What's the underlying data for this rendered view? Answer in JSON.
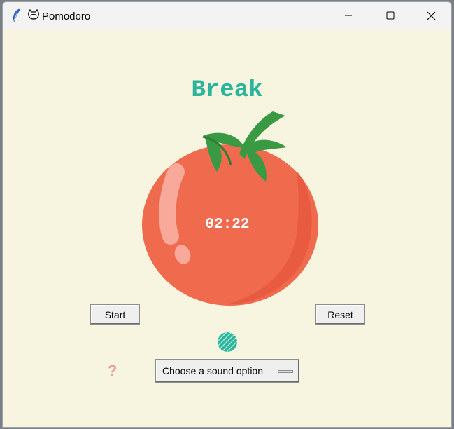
{
  "window": {
    "title": "Pomodoro"
  },
  "main": {
    "heading": "Break",
    "timer": "02:22",
    "heading_color": "#2bb59a",
    "tomato_color": "#f06a4e"
  },
  "buttons": {
    "start": "Start",
    "reset": "Reset"
  },
  "help": {
    "label": "?"
  },
  "sound": {
    "selected": "Choose a sound option"
  }
}
